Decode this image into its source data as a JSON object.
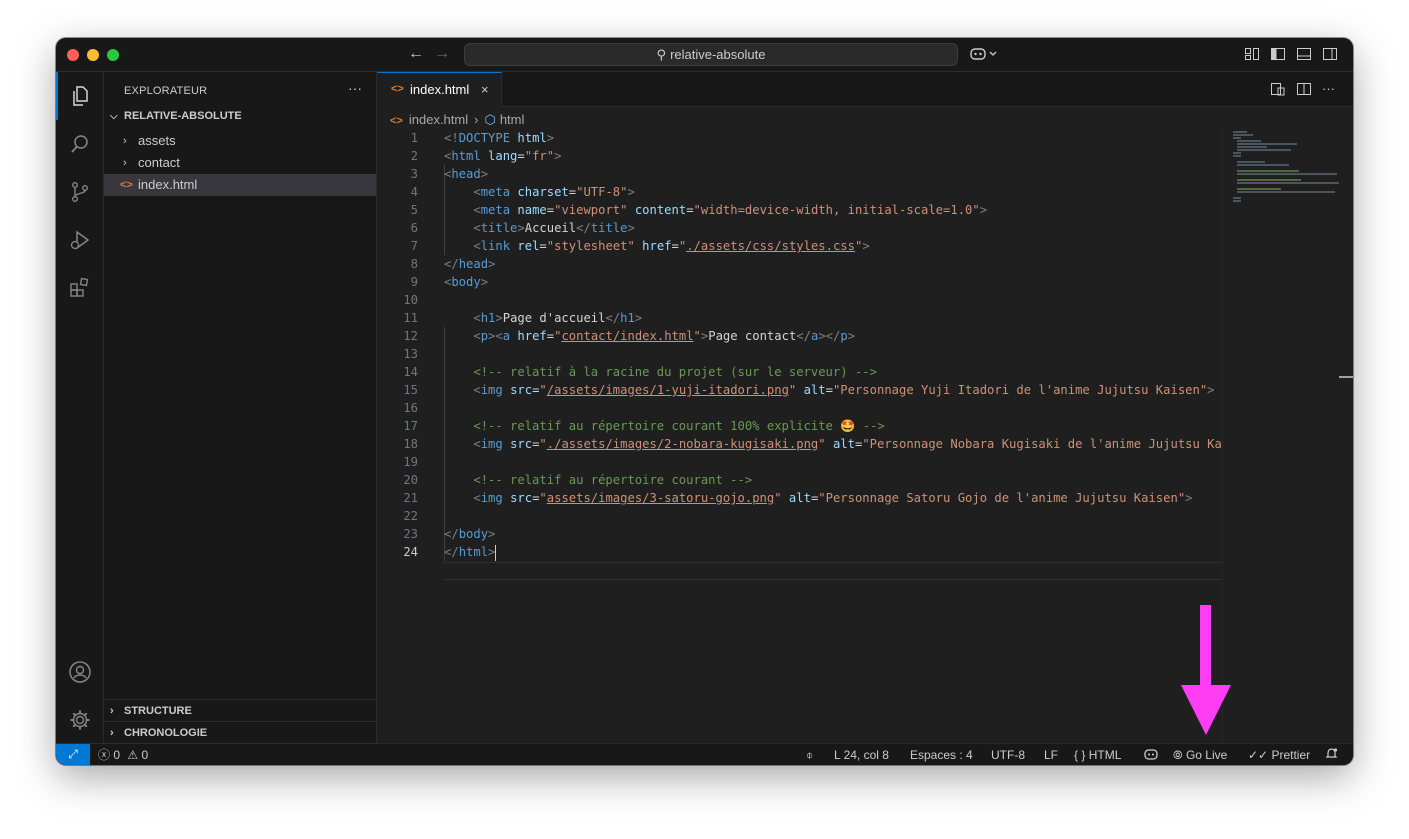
{
  "titlebar": {
    "search_text": "relative-absolute"
  },
  "sidebar": {
    "title": "EXPLORATEUR",
    "more": "···",
    "root": "RELATIVE-ABSOLUTE",
    "items": [
      {
        "label": "assets",
        "type": "folder"
      },
      {
        "label": "contact",
        "type": "folder"
      },
      {
        "label": "index.html",
        "type": "file",
        "selected": true
      }
    ],
    "sections": [
      {
        "label": "STRUCTURE"
      },
      {
        "label": "CHRONOLOGIE"
      }
    ]
  },
  "tab": {
    "label": "index.html",
    "icon": "<>",
    "close": "×"
  },
  "breadcrumb": {
    "file": "index.html",
    "element": "html"
  },
  "code": {
    "line_numbers": [
      "1",
      "2",
      "3",
      "4",
      "5",
      "6",
      "7",
      "8",
      "9",
      "10",
      "11",
      "12",
      "13",
      "14",
      "15",
      "16",
      "17",
      "18",
      "19",
      "20",
      "21",
      "22",
      "23",
      "24"
    ],
    "current_line": 24
  },
  "statusbar": {
    "problems": "0",
    "warnings": "0",
    "position": "L 24, col 8",
    "spaces": "Espaces : 4",
    "encoding": "UTF-8",
    "eol": "LF",
    "language": "HTML",
    "golive": "Go Live",
    "prettier": "Prettier"
  },
  "colors": {
    "accent": "#0078d4",
    "annotation_arrow": "#ff3df5"
  }
}
